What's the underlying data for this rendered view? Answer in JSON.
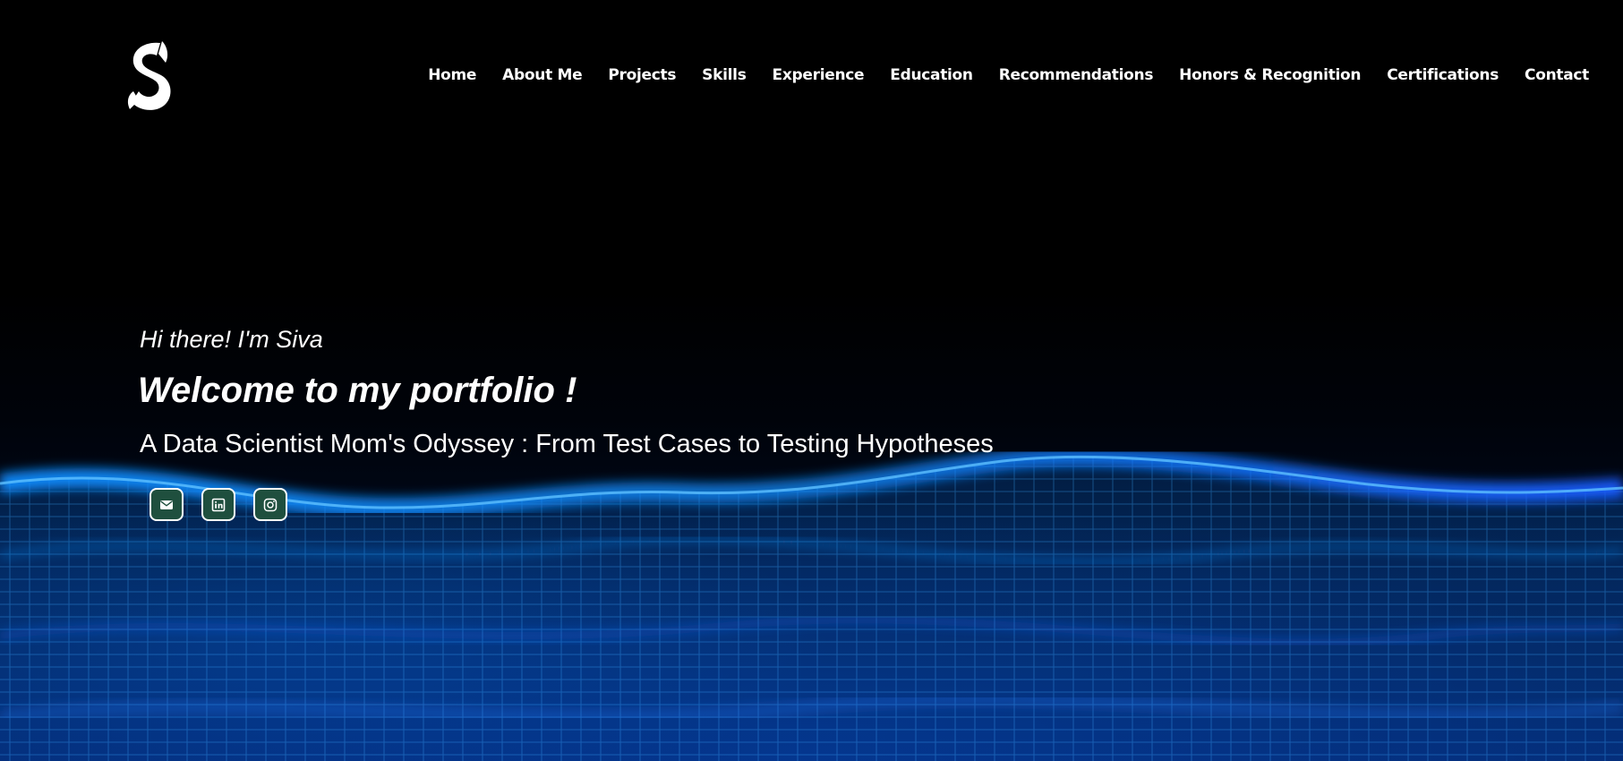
{
  "nav": {
    "items": [
      {
        "label": "Home"
      },
      {
        "label": "About Me"
      },
      {
        "label": "Projects"
      },
      {
        "label": "Skills"
      },
      {
        "label": "Experience"
      },
      {
        "label": "Education"
      },
      {
        "label": "Recommendations"
      },
      {
        "label": "Honors & Recognition"
      },
      {
        "label": "Certifications"
      },
      {
        "label": "Contact"
      }
    ]
  },
  "hero": {
    "greeting": "Hi there! I'm Siva",
    "welcome": "Welcome to my portfolio !",
    "tagline": "A Data Scientist Mom's Odyssey : From Test Cases to Testing Hypotheses"
  },
  "socials": [
    {
      "icon": "mail-icon"
    },
    {
      "icon": "linkedin-icon"
    },
    {
      "icon": "instagram-icon"
    }
  ],
  "colors": {
    "background": "#000000",
    "social_button_bg": "#1f4f3e",
    "wave_accent": "#0a8cff"
  }
}
